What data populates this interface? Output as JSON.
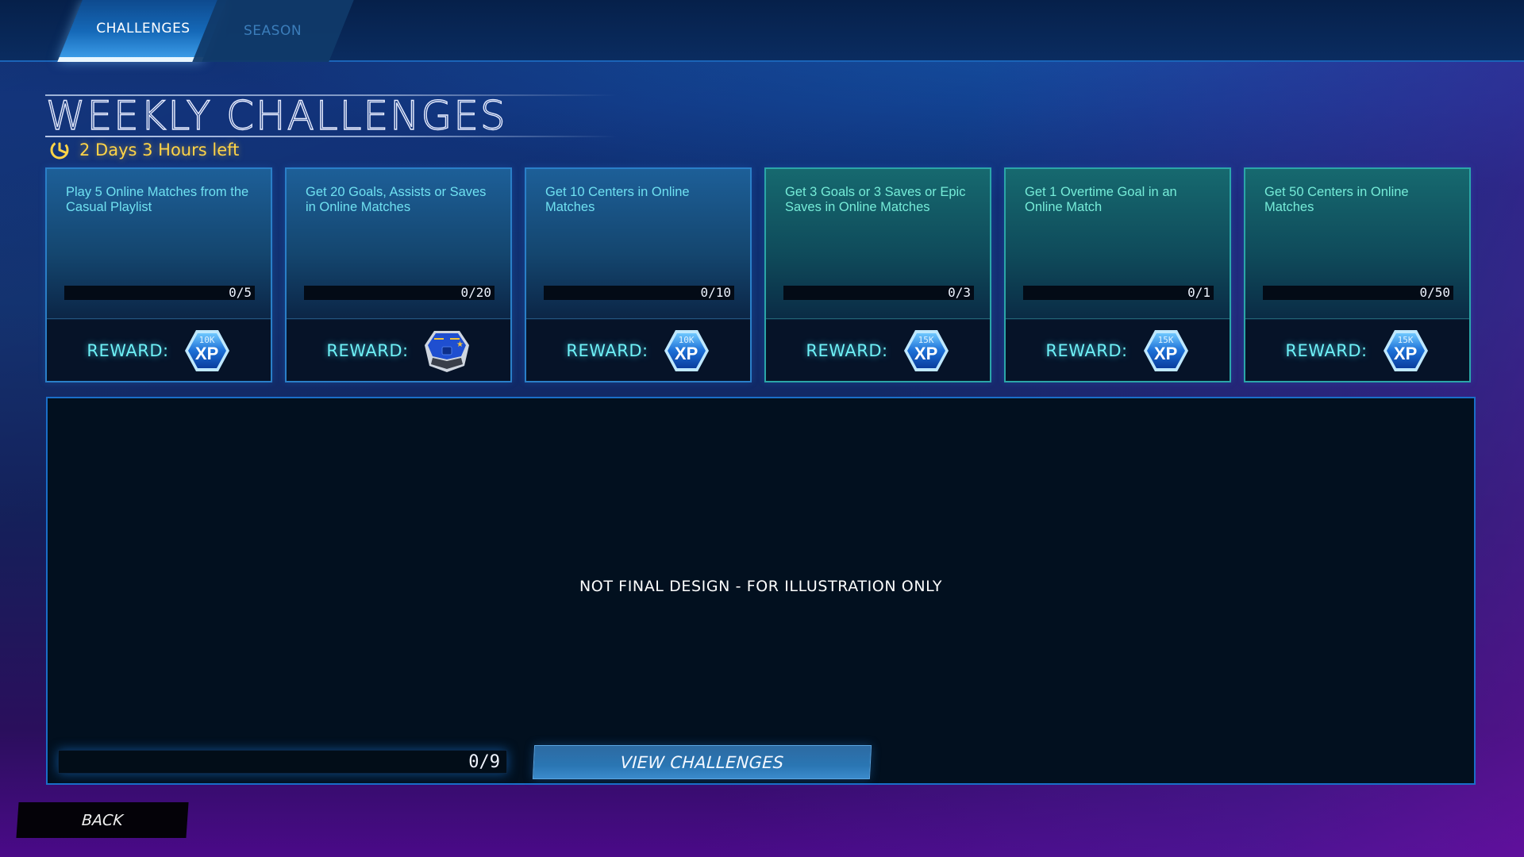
{
  "tabs": [
    {
      "label": "CHALLENGES",
      "active": true
    },
    {
      "label": "SEASON",
      "active": false
    }
  ],
  "header": {
    "title": "WEEKLY CHALLENGES",
    "timer_icon": "timer-icon",
    "time_left": "2 Days 3 Hours left"
  },
  "colors": {
    "accent_blue": "#2a7fc8",
    "accent_teal": "#2ba6a8",
    "timer_yellow": "#ffd447",
    "reward_cyan": "#6ef0f6"
  },
  "challenges": [
    {
      "description": "Play 5 Online Matches from the Casual Playlist",
      "progress_text": "0/5",
      "progress": 0,
      "goal": 5,
      "reward_label": "REWARD:",
      "reward_type": "xp",
      "reward_amount": "10K",
      "reward_text": "XP",
      "theme": "blue"
    },
    {
      "description": "Get 20 Goals, Assists or Saves in Online Matches",
      "progress_text": "0/20",
      "progress": 0,
      "goal": 20,
      "reward_label": "REWARD:",
      "reward_type": "crate-icon",
      "reward_amount": "",
      "reward_text": "",
      "theme": "blue"
    },
    {
      "description": "Get 10 Centers in Online Matches",
      "progress_text": "0/10",
      "progress": 0,
      "goal": 10,
      "reward_label": "REWARD:",
      "reward_type": "xp",
      "reward_amount": "10K",
      "reward_text": "XP",
      "theme": "blue"
    },
    {
      "description": "Get 3 Goals or 3 Saves or Epic Saves in Online Matches",
      "progress_text": "0/3",
      "progress": 0,
      "goal": 3,
      "reward_label": "REWARD:",
      "reward_type": "xp",
      "reward_amount": "15K",
      "reward_text": "XP",
      "theme": "teal"
    },
    {
      "description": "Get 1 Overtime Goal in an Online Match",
      "progress_text": "0/1",
      "progress": 0,
      "goal": 1,
      "reward_label": "REWARD:",
      "reward_type": "xp",
      "reward_amount": "15K",
      "reward_text": "XP",
      "theme": "teal"
    },
    {
      "description": "Get 50 Centers in Online Matches",
      "progress_text": "0/50",
      "progress": 0,
      "goal": 50,
      "reward_label": "REWARD:",
      "reward_type": "xp",
      "reward_amount": "15K",
      "reward_text": "XP",
      "theme": "teal"
    }
  ],
  "panel": {
    "disclaimer": "NOT FINAL DESIGN - FOR ILLUSTRATION ONLY",
    "total_progress_text": "0/9",
    "total_progress": 0,
    "total_goal": 9,
    "view_button": "VIEW CHALLENGES"
  },
  "footer": {
    "back_button": "BACK"
  }
}
